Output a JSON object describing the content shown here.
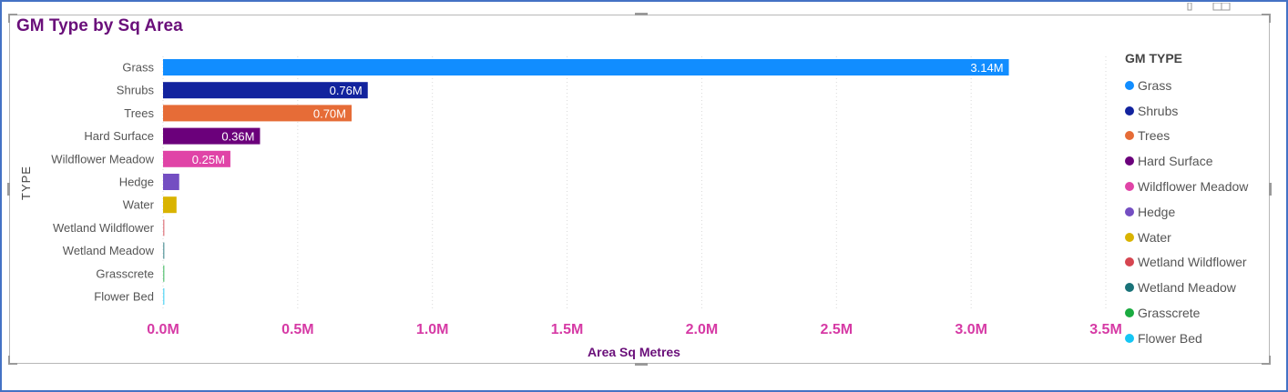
{
  "chart_data": {
    "type": "bar",
    "orientation": "horizontal",
    "title": "GM Type by Sq Area",
    "xlabel": "Area Sq Metres",
    "ylabel": "TYPE",
    "xlim": [
      0,
      3500000
    ],
    "x_ticks": [
      0,
      500000,
      1000000,
      1500000,
      2000000,
      2500000,
      3000000,
      3500000
    ],
    "x_tick_labels": [
      "0.0M",
      "0.5M",
      "1.0M",
      "1.5M",
      "2.0M",
      "2.5M",
      "3.0M",
      "3.5M"
    ],
    "grid": "vertical dotted",
    "legend_title": "GM TYPE",
    "legend_position": "right",
    "categories": [
      "Grass",
      "Shrubs",
      "Trees",
      "Hard Surface",
      "Wildflower Meadow",
      "Hedge",
      "Water",
      "Wetland Wildflower",
      "Wetland Meadow",
      "Grasscrete",
      "Flower Bed"
    ],
    "values": [
      3140000,
      760000,
      700000,
      360000,
      250000,
      60000,
      50000,
      5000,
      3000,
      2000,
      1000
    ],
    "data_labels": [
      "3.14M",
      "0.76M",
      "0.70M",
      "0.36M",
      "0.25M",
      "",
      "",
      "",
      "",
      "",
      ""
    ],
    "colors": [
      "#118dff",
      "#12239e",
      "#e66c37",
      "#6b007b",
      "#e044a7",
      "#744ec2",
      "#d9b300",
      "#d64550",
      "#197278",
      "#1aab40",
      "#15c6f4"
    ]
  }
}
